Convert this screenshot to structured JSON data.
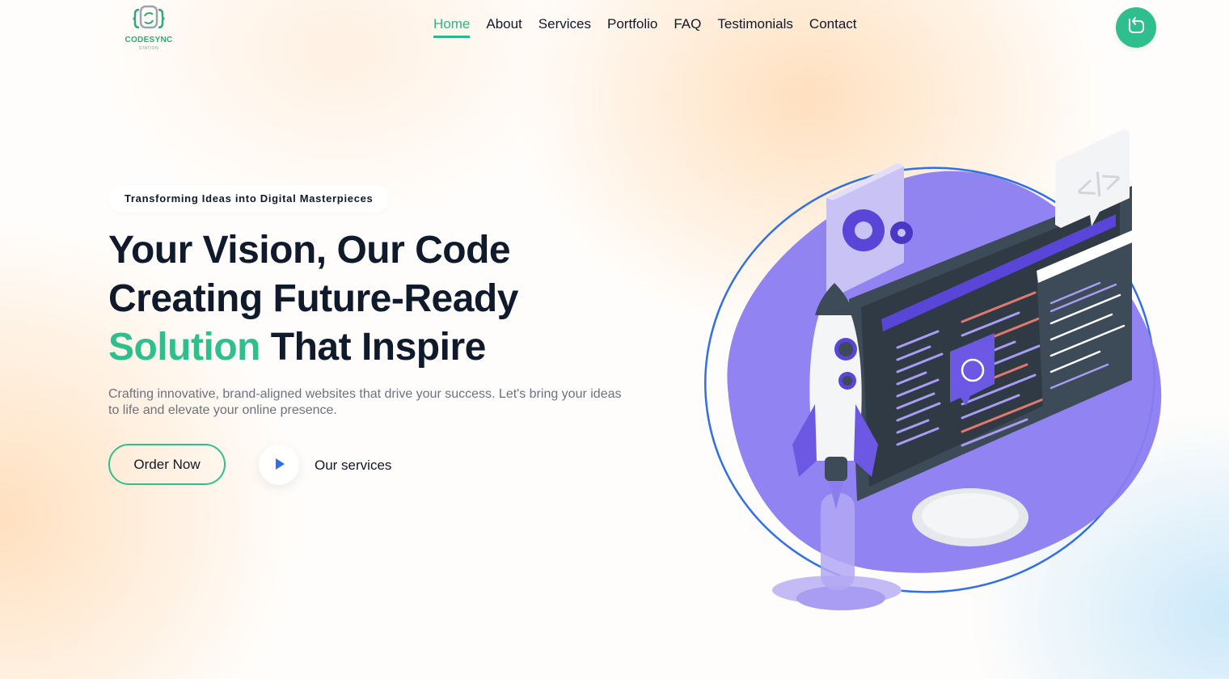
{
  "logo": {
    "name": "CODESYNC",
    "subtitle": "STATION"
  },
  "nav": {
    "items": [
      {
        "label": "Home",
        "active": true
      },
      {
        "label": "About"
      },
      {
        "label": "Services"
      },
      {
        "label": "Portfolio"
      },
      {
        "label": "FAQ"
      },
      {
        "label": "Testimonials"
      },
      {
        "label": "Contact"
      }
    ]
  },
  "hero": {
    "tagline": "Transforming Ideas into Digital Masterpieces",
    "headline": {
      "line1": "Your Vision, Our Code",
      "line2": "Creating Future-Ready",
      "line3_highlight": "Solution",
      "line3_rest": " That Inspire"
    },
    "description": "Crafting innovative, brand-aligned websites that drive your success. Let's bring your ideas to life and elevate your online presence.",
    "order_button": "Order Now",
    "services_link": "Our services"
  },
  "icons": {
    "logo": "code-brackets-logo-icon",
    "corner": "refresh-icon",
    "play": "play-icon",
    "illustration": "rocket-monitor-illustration"
  },
  "colors": {
    "accent_green": "#2fbf8e",
    "heading_dark": "#0f1a2c",
    "illustration_purple": "#8b7cf0",
    "play_blue": "#2f6fe8"
  }
}
